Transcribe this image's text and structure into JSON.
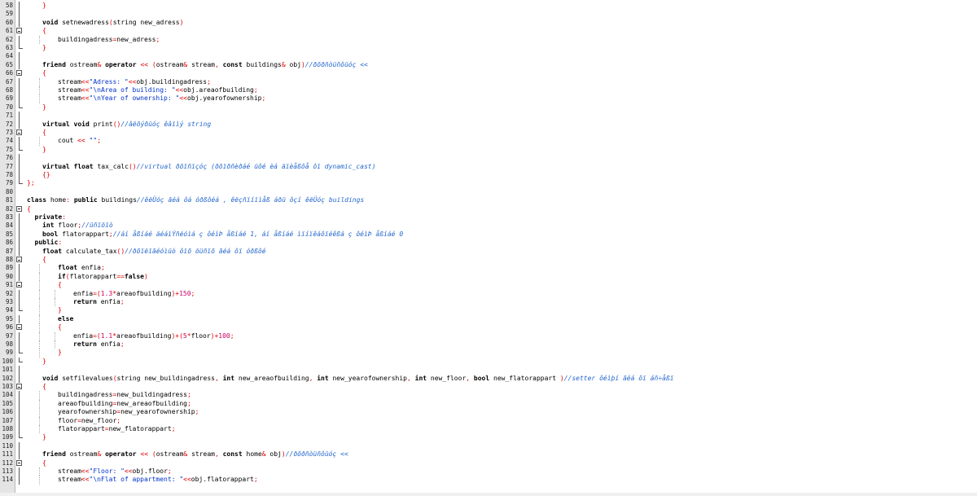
{
  "editor": {
    "theme": {
      "keyword": "#000000",
      "operator": "#e00000",
      "string": "#0033cc",
      "number": "#cc0066",
      "comment": "#2266cc"
    },
    "lines": [
      {
        "n": "58",
        "fold": "bar",
        "indent": 1,
        "tokens": [
          [
            "op",
            "}"
          ]
        ]
      },
      {
        "n": "59",
        "fold": "bar",
        "indent": 1,
        "tokens": []
      },
      {
        "n": "60",
        "fold": "bar",
        "indent": 1,
        "tokens": [
          [
            "kw",
            "void "
          ],
          [
            "t",
            "setnewadress"
          ],
          [
            "op",
            "("
          ],
          [
            "t",
            "string new_adress"
          ],
          [
            "op",
            ")"
          ]
        ]
      },
      {
        "n": "61",
        "fold": "box",
        "indent": 1,
        "tokens": [
          [
            "op",
            "{"
          ]
        ]
      },
      {
        "n": "62",
        "fold": "bar",
        "indent": 2,
        "tokens": [
          [
            "t",
            "buildingadress"
          ],
          [
            "op",
            "="
          ],
          [
            "t",
            "new_adress"
          ],
          [
            "op",
            ";"
          ]
        ]
      },
      {
        "n": "63",
        "fold": "end",
        "indent": 1,
        "tokens": [
          [
            "op",
            "}"
          ]
        ]
      },
      {
        "n": "64",
        "fold": "bar",
        "indent": 1,
        "tokens": []
      },
      {
        "n": "65",
        "fold": "bar",
        "indent": 1,
        "tokens": [
          [
            "kw",
            "friend "
          ],
          [
            "t",
            "ostream"
          ],
          [
            "op",
            "& "
          ],
          [
            "kw",
            "operator "
          ],
          [
            "op",
            "<< ("
          ],
          [
            "t",
            "ostream"
          ],
          [
            "op",
            "& "
          ],
          [
            "t",
            "stream"
          ],
          [
            "op",
            ", "
          ],
          [
            "kw",
            "const "
          ],
          [
            "t",
            "buildings"
          ],
          [
            "op",
            "& "
          ],
          [
            "t",
            "obj"
          ],
          [
            "op",
            ")"
          ],
          [
            "cm",
            "//ðõðñòüñôüóç <<"
          ]
        ]
      },
      {
        "n": "66",
        "fold": "box",
        "indent": 1,
        "tokens": [
          [
            "op",
            "{"
          ]
        ]
      },
      {
        "n": "67",
        "fold": "bar",
        "indent": 2,
        "tokens": [
          [
            "t",
            "stream"
          ],
          [
            "op",
            "<<"
          ],
          [
            "str",
            "\"Adress: \""
          ],
          [
            "op",
            "<<"
          ],
          [
            "t",
            "obj.buildingadress"
          ],
          [
            "op",
            ";"
          ]
        ]
      },
      {
        "n": "68",
        "fold": "bar",
        "indent": 2,
        "tokens": [
          [
            "t",
            "stream"
          ],
          [
            "op",
            "<<"
          ],
          [
            "str",
            "\"\\nArea of building: \""
          ],
          [
            "op",
            "<<"
          ],
          [
            "t",
            "obj.areaofbuilding"
          ],
          [
            "op",
            ";"
          ]
        ]
      },
      {
        "n": "69",
        "fold": "bar",
        "indent": 2,
        "tokens": [
          [
            "t",
            "stream"
          ],
          [
            "op",
            "<<"
          ],
          [
            "str",
            "\"\\nYear of ownership: \""
          ],
          [
            "op",
            "<<"
          ],
          [
            "t",
            "obj.yearofownership"
          ],
          [
            "op",
            ";"
          ]
        ]
      },
      {
        "n": "70",
        "fold": "end",
        "indent": 1,
        "tokens": [
          [
            "op",
            "}"
          ]
        ]
      },
      {
        "n": "71",
        "fold": "bar",
        "indent": 1,
        "tokens": []
      },
      {
        "n": "72",
        "fold": "bar",
        "indent": 1,
        "tokens": [
          [
            "kw",
            "virtual void "
          ],
          [
            "t",
            "print"
          ],
          [
            "op",
            "()"
          ],
          [
            "cm",
            "//âëõýðüóç êâïìý string"
          ]
        ]
      },
      {
        "n": "73",
        "fold": "box",
        "indent": 1,
        "tokens": [
          [
            "op",
            "{"
          ]
        ]
      },
      {
        "n": "74",
        "fold": "bar",
        "indent": 2,
        "tokens": [
          [
            "t",
            "cout "
          ],
          [
            "op",
            "<< "
          ],
          [
            "str",
            "\"\""
          ],
          [
            "op",
            ";"
          ]
        ]
      },
      {
        "n": "75",
        "fold": "end",
        "indent": 1,
        "tokens": [
          [
            "op",
            "}"
          ]
        ]
      },
      {
        "n": "76",
        "fold": "bar",
        "indent": 1,
        "tokens": []
      },
      {
        "n": "77",
        "fold": "bar",
        "indent": 1,
        "tokens": [
          [
            "kw",
            "virtual float "
          ],
          [
            "t",
            "tax_calc"
          ],
          [
            "op",
            "()"
          ],
          [
            "cm",
            "//virtual ðõïñïçóç (ðõïðñèðáé üôé èá äïèåßôå ôï dynamic_cast)"
          ]
        ]
      },
      {
        "n": "78",
        "fold": "bar",
        "indent": 1,
        "tokens": [
          [
            "op",
            "{}"
          ]
        ]
      },
      {
        "n": "79",
        "fold": "end",
        "indent": 0,
        "tokens": [
          [
            "op",
            "};"
          ]
        ]
      },
      {
        "n": "80",
        "fold": "none",
        "indent": 0,
        "tokens": []
      },
      {
        "n": "81",
        "fold": "none",
        "indent": 0,
        "tokens": [
          [
            "kw",
            "class "
          ],
          [
            "t",
            "home"
          ],
          [
            "op",
            ": "
          ],
          [
            "kw",
            "public "
          ],
          [
            "t",
            "buildings"
          ],
          [
            "cm",
            "//êëÜóç ãéá ôá óðßôéá , êëçñïíïìåß áðü ôçí êëÜóç buildings"
          ]
        ]
      },
      {
        "n": "82",
        "fold": "box",
        "indent": 0,
        "tokens": [
          [
            "op",
            "{"
          ]
        ]
      },
      {
        "n": "83",
        "fold": "bar",
        "indent": 0.5,
        "tokens": [
          [
            "kw",
            "private"
          ],
          [
            "op",
            ":"
          ]
        ]
      },
      {
        "n": "84",
        "fold": "bar",
        "indent": 1,
        "tokens": [
          [
            "kw",
            "int "
          ],
          [
            "t",
            "floor"
          ],
          [
            "op",
            ";"
          ],
          [
            "cm",
            "//üñïöïò"
          ]
        ]
      },
      {
        "n": "85",
        "fold": "bar",
        "indent": 1,
        "tokens": [
          [
            "kw",
            "bool "
          ],
          [
            "t",
            "flatorappart"
          ],
          [
            "op",
            ";"
          ],
          [
            "cm",
            "//áí åßíáé äéáìÝñéóìá ç ôéìÞ åßíáé 1, áí åßíáé ìïíïêáôïéêßá ç ôéìÞ åßíáé 0"
          ]
        ]
      },
      {
        "n": "86",
        "fold": "bar",
        "indent": 0.5,
        "tokens": [
          [
            "kw",
            "public"
          ],
          [
            "op",
            ":"
          ]
        ]
      },
      {
        "n": "87",
        "fold": "bar",
        "indent": 1,
        "tokens": [
          [
            "kw",
            "float "
          ],
          [
            "t",
            "calculate_tax"
          ],
          [
            "op",
            "()"
          ],
          [
            "cm",
            "//ðõïëïãéóìüò ôïõ öüñïõ ãéá ôï óðßôé"
          ]
        ]
      },
      {
        "n": "88",
        "fold": "box",
        "indent": 1,
        "tokens": [
          [
            "op",
            "{"
          ]
        ]
      },
      {
        "n": "89",
        "fold": "bar",
        "indent": 2,
        "tokens": [
          [
            "kw",
            "float "
          ],
          [
            "t",
            "enfia"
          ],
          [
            "op",
            ";"
          ]
        ]
      },
      {
        "n": "90",
        "fold": "bar",
        "indent": 2,
        "tokens": [
          [
            "kw",
            "if"
          ],
          [
            "op",
            "("
          ],
          [
            "t",
            "flatorappart"
          ],
          [
            "op",
            "=="
          ],
          [
            "kw",
            "false"
          ],
          [
            "op",
            ")"
          ]
        ]
      },
      {
        "n": "91",
        "fold": "box",
        "indent": 2,
        "tokens": [
          [
            "op",
            "{"
          ]
        ]
      },
      {
        "n": "92",
        "fold": "bar",
        "indent": 3,
        "tokens": [
          [
            "t",
            "enfia"
          ],
          [
            "op",
            "=("
          ],
          [
            "num",
            "1.3"
          ],
          [
            "op",
            "*"
          ],
          [
            "t",
            "areaofbuilding"
          ],
          [
            "op",
            ")+"
          ],
          [
            "num",
            "150"
          ],
          [
            "op",
            ";"
          ]
        ]
      },
      {
        "n": "93",
        "fold": "bar",
        "indent": 3,
        "tokens": [
          [
            "kw",
            "return "
          ],
          [
            "t",
            "enfia"
          ],
          [
            "op",
            ";"
          ]
        ]
      },
      {
        "n": "94",
        "fold": "end",
        "indent": 2,
        "tokens": [
          [
            "op",
            "}"
          ]
        ]
      },
      {
        "n": "95",
        "fold": "bar",
        "indent": 2,
        "tokens": [
          [
            "kw",
            "else"
          ]
        ]
      },
      {
        "n": "96",
        "fold": "box",
        "indent": 2,
        "tokens": [
          [
            "op",
            "{"
          ]
        ]
      },
      {
        "n": "97",
        "fold": "bar",
        "indent": 3,
        "tokens": [
          [
            "t",
            "enfia"
          ],
          [
            "op",
            "=("
          ],
          [
            "num",
            "1.1"
          ],
          [
            "op",
            "*"
          ],
          [
            "t",
            "areaofbuilding"
          ],
          [
            "op",
            ")+("
          ],
          [
            "num",
            "5"
          ],
          [
            "op",
            "*"
          ],
          [
            "t",
            "floor"
          ],
          [
            "op",
            ")+"
          ],
          [
            "num",
            "100"
          ],
          [
            "op",
            ";"
          ]
        ]
      },
      {
        "n": "98",
        "fold": "bar",
        "indent": 3,
        "tokens": [
          [
            "kw",
            "return "
          ],
          [
            "t",
            "enfia"
          ],
          [
            "op",
            ";"
          ]
        ]
      },
      {
        "n": "99",
        "fold": "end",
        "indent": 2,
        "tokens": [
          [
            "op",
            "}"
          ]
        ]
      },
      {
        "n": "100",
        "fold": "end",
        "indent": 1,
        "tokens": [
          [
            "op",
            "}"
          ]
        ]
      },
      {
        "n": "101",
        "fold": "bar",
        "indent": 1,
        "tokens": []
      },
      {
        "n": "102",
        "fold": "bar",
        "indent": 1,
        "tokens": [
          [
            "kw",
            "void "
          ],
          [
            "t",
            "setfilevalues"
          ],
          [
            "op",
            "("
          ],
          [
            "t",
            "string new_buildingadress"
          ],
          [
            "op",
            ", "
          ],
          [
            "kw",
            "int "
          ],
          [
            "t",
            "new_areaofbuilding"
          ],
          [
            "op",
            ", "
          ],
          [
            "kw",
            "int "
          ],
          [
            "t",
            "new_yearofownership"
          ],
          [
            "op",
            ", "
          ],
          [
            "kw",
            "int "
          ],
          [
            "t",
            "new_floor"
          ],
          [
            "op",
            ", "
          ],
          [
            "kw",
            "bool "
          ],
          [
            "t",
            "new_flatorappart "
          ],
          [
            "op",
            ")"
          ],
          [
            "cm",
            "//setter ôéìþí ãéá ôï áñ÷åßï"
          ]
        ]
      },
      {
        "n": "103",
        "fold": "box",
        "indent": 1,
        "tokens": [
          [
            "op",
            "{"
          ]
        ]
      },
      {
        "n": "104",
        "fold": "bar",
        "indent": 2,
        "tokens": [
          [
            "t",
            "buildingadress"
          ],
          [
            "op",
            "="
          ],
          [
            "t",
            "new_buildingadress"
          ],
          [
            "op",
            ";"
          ]
        ]
      },
      {
        "n": "105",
        "fold": "bar",
        "indent": 2,
        "tokens": [
          [
            "t",
            "areaofbuilding"
          ],
          [
            "op",
            "="
          ],
          [
            "t",
            "new_areaofbuilding"
          ],
          [
            "op",
            ";"
          ]
        ]
      },
      {
        "n": "106",
        "fold": "bar",
        "indent": 2,
        "tokens": [
          [
            "t",
            "yearofownership"
          ],
          [
            "op",
            "="
          ],
          [
            "t",
            "new_yearofownership"
          ],
          [
            "op",
            ";"
          ]
        ]
      },
      {
        "n": "107",
        "fold": "bar",
        "indent": 2,
        "tokens": [
          [
            "t",
            "floor"
          ],
          [
            "op",
            "="
          ],
          [
            "t",
            "new_floor"
          ],
          [
            "op",
            ";"
          ]
        ]
      },
      {
        "n": "108",
        "fold": "bar",
        "indent": 2,
        "tokens": [
          [
            "t",
            "flatorappart"
          ],
          [
            "op",
            "="
          ],
          [
            "t",
            "new_flatorappart"
          ],
          [
            "op",
            ";"
          ]
        ]
      },
      {
        "n": "109",
        "fold": "end",
        "indent": 1,
        "tokens": [
          [
            "op",
            "}"
          ]
        ]
      },
      {
        "n": "110",
        "fold": "bar",
        "indent": 1,
        "tokens": []
      },
      {
        "n": "111",
        "fold": "bar",
        "indent": 1,
        "tokens": [
          [
            "kw",
            "friend "
          ],
          [
            "t",
            "ostream"
          ],
          [
            "op",
            "& "
          ],
          [
            "kw",
            "operator "
          ],
          [
            "op",
            "<< ("
          ],
          [
            "t",
            "ostream"
          ],
          [
            "op",
            "& "
          ],
          [
            "t",
            "stream"
          ],
          [
            "op",
            ", "
          ],
          [
            "kw",
            "const "
          ],
          [
            "t",
            "home"
          ],
          [
            "op",
            "& "
          ],
          [
            "t",
            "obj"
          ],
          [
            "op",
            ")"
          ],
          [
            "cm",
            "//ðõðñòüñôüóç <<"
          ]
        ]
      },
      {
        "n": "112",
        "fold": "box",
        "indent": 1,
        "tokens": [
          [
            "op",
            "{"
          ]
        ]
      },
      {
        "n": "113",
        "fold": "bar",
        "indent": 2,
        "tokens": [
          [
            "t",
            "stream"
          ],
          [
            "op",
            "<<"
          ],
          [
            "str",
            "\"Floor: \""
          ],
          [
            "op",
            "<<"
          ],
          [
            "t",
            "obj.floor"
          ],
          [
            "op",
            ";"
          ]
        ]
      },
      {
        "n": "114",
        "fold": "bar",
        "indent": 2,
        "tokens": [
          [
            "t",
            "stream"
          ],
          [
            "op",
            "<<"
          ],
          [
            "str",
            "\"\\nFlat of appartment: \""
          ],
          [
            "op",
            "<<"
          ],
          [
            "t",
            "obj.flatorappart"
          ],
          [
            "op",
            ";"
          ]
        ]
      }
    ]
  }
}
